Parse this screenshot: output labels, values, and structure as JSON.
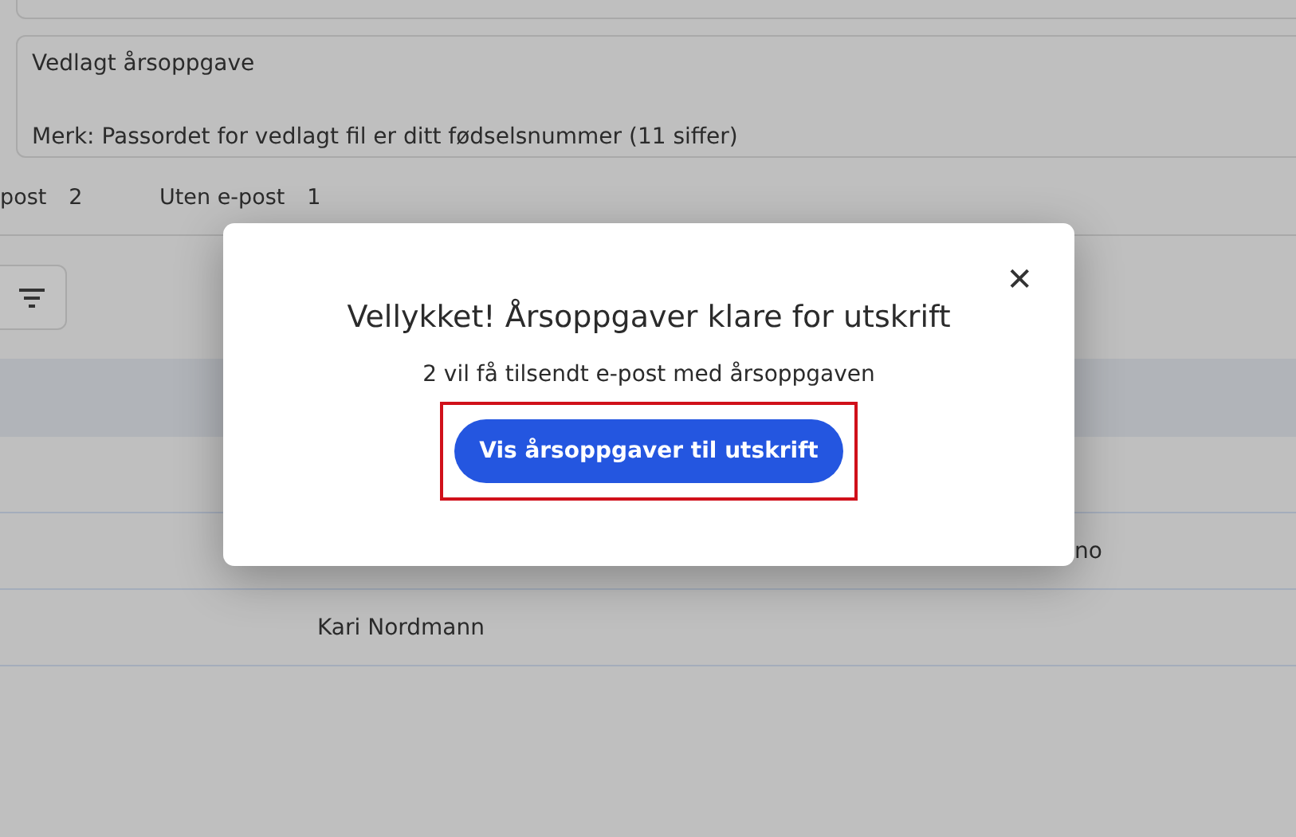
{
  "message": {
    "value": "Vedlagt årsoppgave\n\nMerk: Passordet for vedlagt fil er ditt fødselsnummer (11 siffer)"
  },
  "counts": [
    {
      "label": "post",
      "count": "2"
    },
    {
      "label": "Uten e-post",
      "count": "1"
    }
  ],
  "table": {
    "rows": [
      {},
      {
        "column_4": "no"
      },
      {
        "column_2": "Kari Nordmann"
      }
    ]
  },
  "dialog": {
    "close": "✕",
    "title": "Vellykket! Årsoppgaver klare for utskrift",
    "text": "2 vil få tilsendt e-post med årsoppgaven",
    "button": {
      "label": "Vis årsoppgaver til utskrift",
      "highlighted": true
    }
  }
}
